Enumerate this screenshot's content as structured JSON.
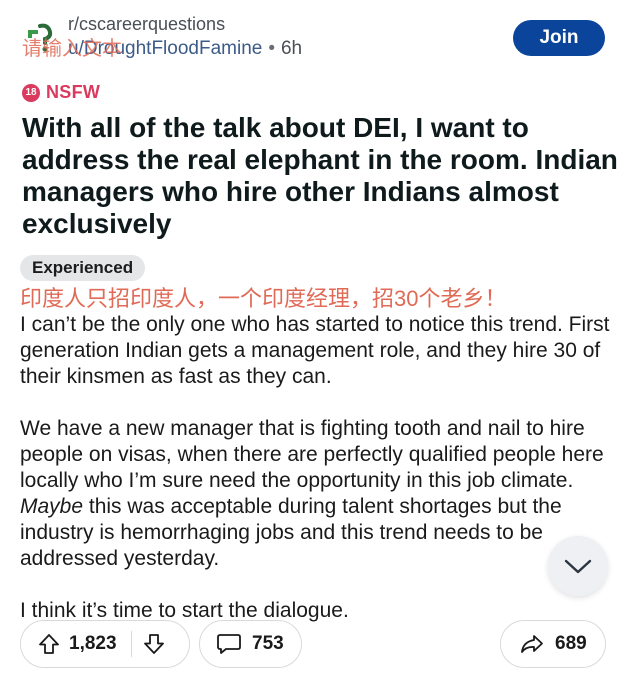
{
  "header": {
    "subreddit": "r/cscareerquestions",
    "user": "u/DroughtFloodFamine",
    "separator": "•",
    "time": "6h",
    "input_placeholder": "请输入文本",
    "join_label": "Join"
  },
  "post": {
    "nsfw_badge_number": "18",
    "nsfw_label": "NSFW",
    "title": "With all of the talk about DEI, I want to address the real elephant in the room. Indian managers who hire other Indians almost exclusively",
    "flair": "Experienced",
    "annotation": "印度人只招印度人，一个印度经理，招30个老乡！",
    "body_p1": "I can’t be the only one who has started to notice this trend. First generation Indian gets a management role, and they hire 30 of their kinsmen as fast as they can.",
    "body_p2_part1": "We have a new manager that is fighting tooth and nail to hire people on visas, when there are perfectly qualified people here locally who I’m sure need the opportunity in this job climate. ",
    "body_p2_italic": "Maybe",
    "body_p2_part2": " this was acceptable during talent shortages but the industry is hemorrhaging jobs and this trend needs to be addressed yesterday.",
    "body_p3": "I think it’s time to start the dialogue."
  },
  "actions": {
    "upvotes": "1,823",
    "comments": "753",
    "shares": "689"
  },
  "icons": {
    "upvote": "upvote-arrow-icon",
    "downvote": "downvote-arrow-icon",
    "comment": "comment-bubble-icon",
    "share": "share-arrow-icon",
    "scroll": "chevron-down-icon",
    "avatar": "subreddit-avatar-icon",
    "nsfw": "nsfw-18-icon"
  },
  "colors": {
    "join_button": "#0a449b",
    "nsfw": "#d93a5e",
    "annotation": "#e06a55",
    "username": "#3c5b88"
  }
}
